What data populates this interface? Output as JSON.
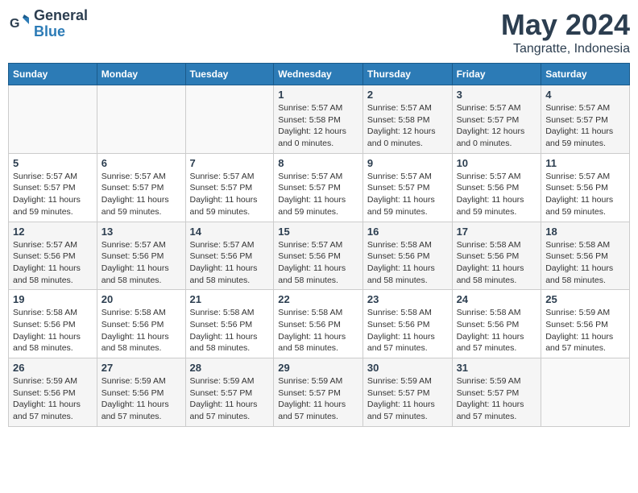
{
  "logo": {
    "line1": "General",
    "line2": "Blue"
  },
  "title": "May 2024",
  "location": "Tangratte, Indonesia",
  "weekdays": [
    "Sunday",
    "Monday",
    "Tuesday",
    "Wednesday",
    "Thursday",
    "Friday",
    "Saturday"
  ],
  "weeks": [
    [
      {
        "day": "",
        "info": ""
      },
      {
        "day": "",
        "info": ""
      },
      {
        "day": "",
        "info": ""
      },
      {
        "day": "1",
        "info": "Sunrise: 5:57 AM\nSunset: 5:58 PM\nDaylight: 12 hours\nand 0 minutes."
      },
      {
        "day": "2",
        "info": "Sunrise: 5:57 AM\nSunset: 5:58 PM\nDaylight: 12 hours\nand 0 minutes."
      },
      {
        "day": "3",
        "info": "Sunrise: 5:57 AM\nSunset: 5:57 PM\nDaylight: 12 hours\nand 0 minutes."
      },
      {
        "day": "4",
        "info": "Sunrise: 5:57 AM\nSunset: 5:57 PM\nDaylight: 11 hours\nand 59 minutes."
      }
    ],
    [
      {
        "day": "5",
        "info": "Sunrise: 5:57 AM\nSunset: 5:57 PM\nDaylight: 11 hours\nand 59 minutes."
      },
      {
        "day": "6",
        "info": "Sunrise: 5:57 AM\nSunset: 5:57 PM\nDaylight: 11 hours\nand 59 minutes."
      },
      {
        "day": "7",
        "info": "Sunrise: 5:57 AM\nSunset: 5:57 PM\nDaylight: 11 hours\nand 59 minutes."
      },
      {
        "day": "8",
        "info": "Sunrise: 5:57 AM\nSunset: 5:57 PM\nDaylight: 11 hours\nand 59 minutes."
      },
      {
        "day": "9",
        "info": "Sunrise: 5:57 AM\nSunset: 5:57 PM\nDaylight: 11 hours\nand 59 minutes."
      },
      {
        "day": "10",
        "info": "Sunrise: 5:57 AM\nSunset: 5:56 PM\nDaylight: 11 hours\nand 59 minutes."
      },
      {
        "day": "11",
        "info": "Sunrise: 5:57 AM\nSunset: 5:56 PM\nDaylight: 11 hours\nand 59 minutes."
      }
    ],
    [
      {
        "day": "12",
        "info": "Sunrise: 5:57 AM\nSunset: 5:56 PM\nDaylight: 11 hours\nand 58 minutes."
      },
      {
        "day": "13",
        "info": "Sunrise: 5:57 AM\nSunset: 5:56 PM\nDaylight: 11 hours\nand 58 minutes."
      },
      {
        "day": "14",
        "info": "Sunrise: 5:57 AM\nSunset: 5:56 PM\nDaylight: 11 hours\nand 58 minutes."
      },
      {
        "day": "15",
        "info": "Sunrise: 5:57 AM\nSunset: 5:56 PM\nDaylight: 11 hours\nand 58 minutes."
      },
      {
        "day": "16",
        "info": "Sunrise: 5:58 AM\nSunset: 5:56 PM\nDaylight: 11 hours\nand 58 minutes."
      },
      {
        "day": "17",
        "info": "Sunrise: 5:58 AM\nSunset: 5:56 PM\nDaylight: 11 hours\nand 58 minutes."
      },
      {
        "day": "18",
        "info": "Sunrise: 5:58 AM\nSunset: 5:56 PM\nDaylight: 11 hours\nand 58 minutes."
      }
    ],
    [
      {
        "day": "19",
        "info": "Sunrise: 5:58 AM\nSunset: 5:56 PM\nDaylight: 11 hours\nand 58 minutes."
      },
      {
        "day": "20",
        "info": "Sunrise: 5:58 AM\nSunset: 5:56 PM\nDaylight: 11 hours\nand 58 minutes."
      },
      {
        "day": "21",
        "info": "Sunrise: 5:58 AM\nSunset: 5:56 PM\nDaylight: 11 hours\nand 58 minutes."
      },
      {
        "day": "22",
        "info": "Sunrise: 5:58 AM\nSunset: 5:56 PM\nDaylight: 11 hours\nand 58 minutes."
      },
      {
        "day": "23",
        "info": "Sunrise: 5:58 AM\nSunset: 5:56 PM\nDaylight: 11 hours\nand 57 minutes."
      },
      {
        "day": "24",
        "info": "Sunrise: 5:58 AM\nSunset: 5:56 PM\nDaylight: 11 hours\nand 57 minutes."
      },
      {
        "day": "25",
        "info": "Sunrise: 5:59 AM\nSunset: 5:56 PM\nDaylight: 11 hours\nand 57 minutes."
      }
    ],
    [
      {
        "day": "26",
        "info": "Sunrise: 5:59 AM\nSunset: 5:56 PM\nDaylight: 11 hours\nand 57 minutes."
      },
      {
        "day": "27",
        "info": "Sunrise: 5:59 AM\nSunset: 5:56 PM\nDaylight: 11 hours\nand 57 minutes."
      },
      {
        "day": "28",
        "info": "Sunrise: 5:59 AM\nSunset: 5:57 PM\nDaylight: 11 hours\nand 57 minutes."
      },
      {
        "day": "29",
        "info": "Sunrise: 5:59 AM\nSunset: 5:57 PM\nDaylight: 11 hours\nand 57 minutes."
      },
      {
        "day": "30",
        "info": "Sunrise: 5:59 AM\nSunset: 5:57 PM\nDaylight: 11 hours\nand 57 minutes."
      },
      {
        "day": "31",
        "info": "Sunrise: 5:59 AM\nSunset: 5:57 PM\nDaylight: 11 hours\nand 57 minutes."
      },
      {
        "day": "",
        "info": ""
      }
    ]
  ]
}
